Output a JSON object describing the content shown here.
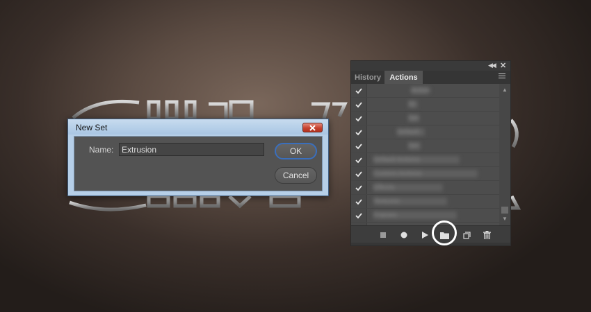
{
  "dialog": {
    "title": "New Set",
    "name_label": "Name:",
    "name_value": "Extrusion",
    "ok_label": "OK",
    "cancel_label": "Cancel"
  },
  "panel": {
    "tabs": [
      {
        "label": "History",
        "active": false
      },
      {
        "label": "Actions",
        "active": true
      }
    ],
    "rows": [
      {
        "checked": true,
        "blurred_text": "Action"
      },
      {
        "checked": true,
        "blurred_text": "St"
      },
      {
        "checked": true,
        "blurred_text": "Set"
      },
      {
        "checked": true,
        "blurred_text": "Default"
      },
      {
        "checked": true,
        "blurred_text": "Set"
      },
      {
        "checked": true,
        "blurred_text": "Default Actions"
      },
      {
        "checked": true,
        "blurred_text": "Custom Actions"
      },
      {
        "checked": true,
        "blurred_text": "Effects"
      },
      {
        "checked": true,
        "blurred_text": "Textures"
      },
      {
        "checked": true,
        "blurred_text": "Frames"
      }
    ],
    "footer_icons": [
      "stop-icon",
      "record-icon",
      "play-icon",
      "new-set-folder-icon",
      "new-action-icon",
      "trash-icon"
    ]
  },
  "colors": {
    "accent_ring": "#ffffff",
    "ok_border": "#3a6fbd",
    "close_red": "#c6422f"
  }
}
